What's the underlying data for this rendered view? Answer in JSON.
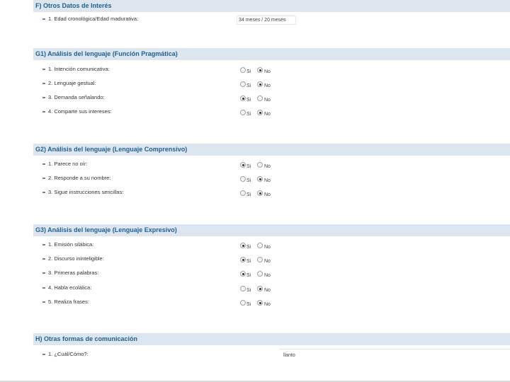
{
  "section_f": {
    "title": "F) Otros Datos de Interés",
    "field_label": "1. Edad cronológica/Edad madurativa:",
    "field_value": "34 meses / 20 meses"
  },
  "section_g1": {
    "title": "G1) Análisis del lenguaje (Función Pragmática)",
    "rows": [
      {
        "label": "1. Intención comunicativa:",
        "si": "Si",
        "no": "No"
      },
      {
        "label": "2. Lenguaje gestual:",
        "si": "Si",
        "no": "No"
      },
      {
        "label": "3. Demanda señalando:",
        "si": "Si",
        "no": "No"
      },
      {
        "label": "4. Comparte sus intereses:",
        "si": "Si",
        "no": "No"
      }
    ]
  },
  "section_g2": {
    "title": "G2) Análisis del lenguaje (Lenguaje Comprensivo)",
    "rows": [
      {
        "label": "1. Parece no oír:",
        "si": "Si",
        "no": "No"
      },
      {
        "label": "2. Responde a su nombre:",
        "si": "Si",
        "no": "No"
      },
      {
        "label": "3. Sigue instrucciones sencillas:",
        "si": "Si",
        "no": "No"
      }
    ]
  },
  "section_g3": {
    "title": "G3) Análisis del lenguaje (Lenguaje Expresivo)",
    "rows": [
      {
        "label": "1. Emisión silábica:",
        "si": "Si",
        "no": "No"
      },
      {
        "label": "2. Discurso ininteligible:",
        "si": "Si",
        "no": "No"
      },
      {
        "label": "3. Primeras palabras:",
        "si": "Si",
        "no": "No"
      },
      {
        "label": "4. Habla ecolálica:",
        "si": "Si",
        "no": "No"
      },
      {
        "label": "5. Realiza frases:",
        "si": "Si",
        "no": "No"
      }
    ]
  },
  "section_h": {
    "title": "H) Otras formas de comunicación",
    "field_label": "1. ¿Cuál/Cómo?:",
    "field_value": "llanto"
  }
}
